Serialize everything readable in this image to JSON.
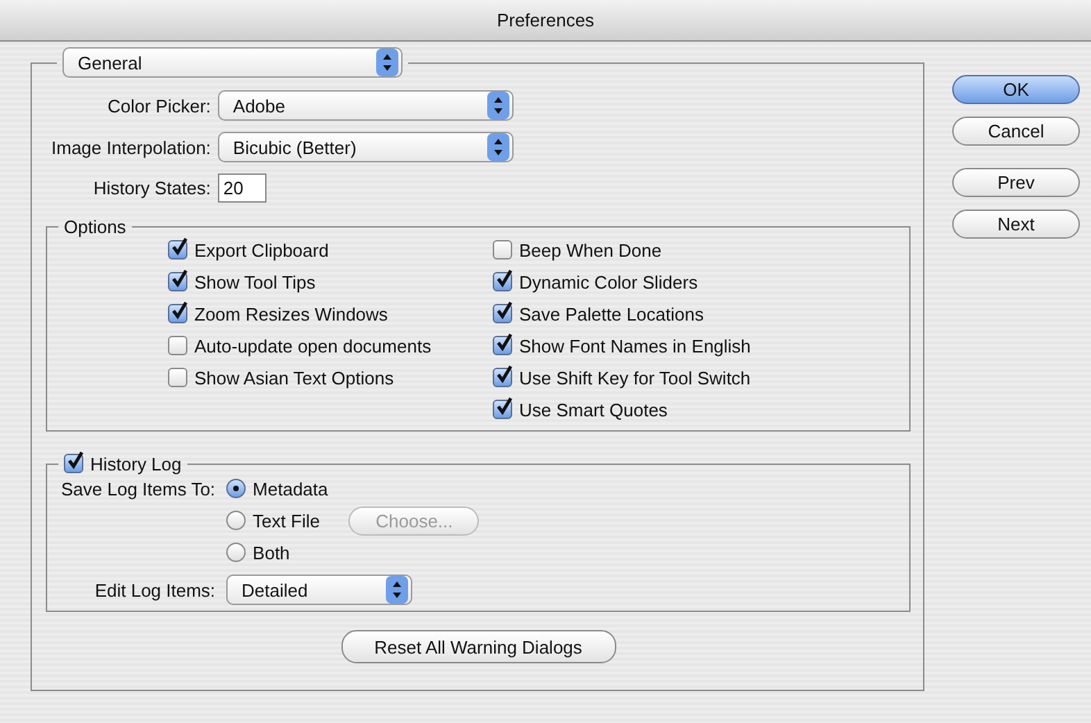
{
  "window": {
    "title": "Preferences"
  },
  "category": {
    "value": "General"
  },
  "fields": [
    {
      "label": "Color Picker:",
      "kind": "popup",
      "value": "Adobe"
    },
    {
      "label": "Image Interpolation:",
      "kind": "popup",
      "value": "Bicubic (Better)"
    },
    {
      "label": "History States:",
      "kind": "text",
      "value": "20"
    }
  ],
  "options": {
    "title": "Options",
    "columns": [
      [
        {
          "label": "Export Clipboard",
          "checked": true
        },
        {
          "label": "Show Tool Tips",
          "checked": true
        },
        {
          "label": "Zoom Resizes Windows",
          "checked": true
        },
        {
          "label": "Auto-update open documents",
          "checked": false
        },
        {
          "label": "Show Asian Text Options",
          "checked": false
        }
      ],
      [
        {
          "label": "Beep When Done",
          "checked": false
        },
        {
          "label": "Dynamic Color Sliders",
          "checked": true
        },
        {
          "label": "Save Palette Locations",
          "checked": true
        },
        {
          "label": "Show Font Names in English",
          "checked": true
        },
        {
          "label": "Use Shift Key for Tool Switch",
          "checked": true
        },
        {
          "label": "Use Smart Quotes",
          "checked": true
        }
      ]
    ]
  },
  "history_log": {
    "label": "History Log",
    "checked": true,
    "save_label": "Save Log Items To:",
    "destinations": [
      {
        "label": "Metadata",
        "selected": true
      },
      {
        "label": "Text File",
        "selected": false,
        "button": {
          "label": "Choose...",
          "disabled": true
        }
      },
      {
        "label": "Both",
        "selected": false
      }
    ],
    "edit_label": "Edit Log Items:",
    "edit_value": "Detailed"
  },
  "reset_button": "Reset All Warning Dialogs",
  "button_groups": [
    [
      {
        "label": "OK",
        "default": true
      },
      {
        "label": "Cancel",
        "default": false
      }
    ],
    [
      {
        "label": "Prev",
        "default": false
      },
      {
        "label": "Next",
        "default": false
      }
    ]
  ]
}
